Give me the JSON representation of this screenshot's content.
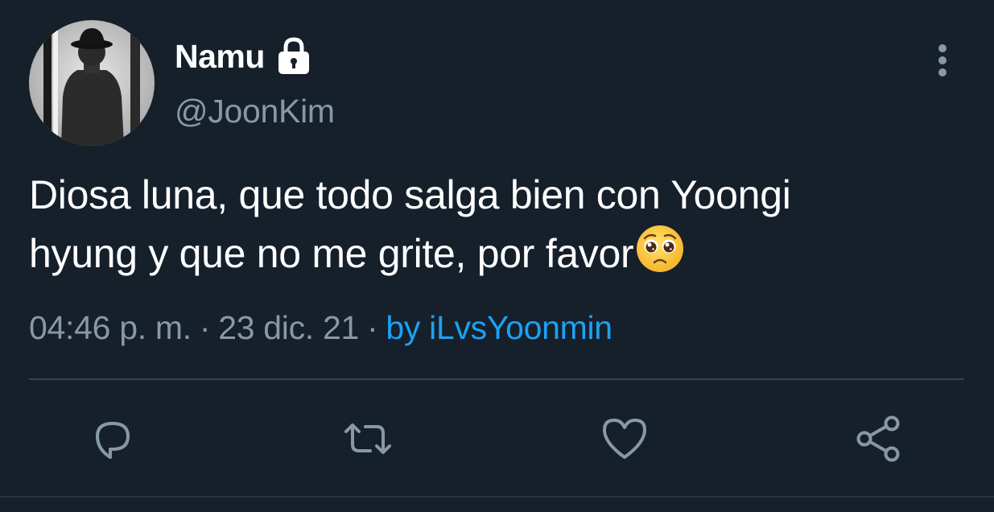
{
  "user": {
    "display_name": "Namu",
    "handle": "@JoonKim",
    "protected_icon": "lock-icon",
    "avatar_icon": "avatar-silhouette"
  },
  "tweet": {
    "text_line1": "Diosa luna, que todo salga bien con Yoongi",
    "text_line2": "hyung y que no me grite, por favor",
    "emoji": "pleading-face-emoji"
  },
  "meta": {
    "time": "04:46 p. m.",
    "separator": "·",
    "date": "23 dic. 21",
    "source": "by iLvsYoonmin"
  },
  "actions": {
    "reply_icon": "reply-icon",
    "retweet_icon": "retweet-icon",
    "like_icon": "heart-icon",
    "share_icon": "share-icon",
    "more_icon": "more-vertical-icon"
  },
  "colors": {
    "background": "#15202b",
    "primary_text": "#ffffff",
    "secondary_text": "#8899a6",
    "link": "#1da1f2",
    "divider": "#38444d"
  }
}
